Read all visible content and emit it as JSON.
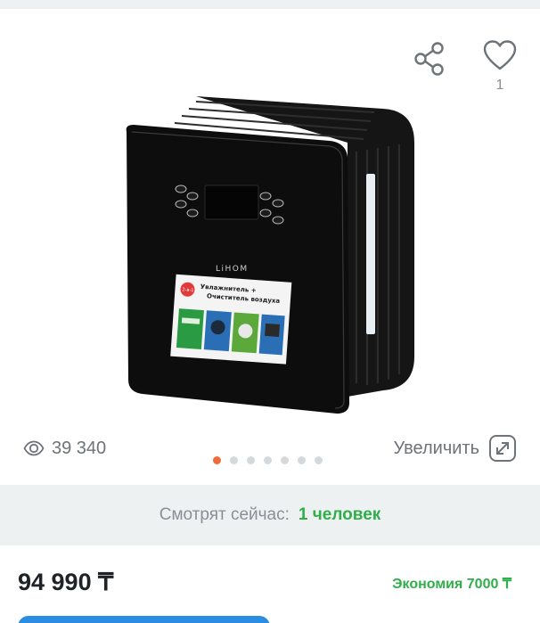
{
  "gallery": {
    "favorites_count": "1",
    "views_count": "39 340",
    "zoom_label": "Увеличить",
    "slides": 7,
    "active_slide": 1,
    "product_image": {
      "brand": "LiHOM",
      "badge": "2-в-1",
      "sticker_line1": "Увлажнитель +",
      "sticker_line2": "Очиститель воздуха"
    }
  },
  "watching": {
    "label": "Смотрят сейчас:",
    "value": "1 человек"
  },
  "price": {
    "amount": "94 990 ₸",
    "saving": "Экономия 7000 ₸"
  },
  "colors": {
    "accent_orange": "#f06b3a",
    "green": "#2fae4a",
    "blue": "#2a8de1",
    "icon_gray": "#6e7378"
  },
  "icons": [
    "share-icon",
    "heart-icon",
    "eye-icon",
    "expand-icon"
  ]
}
